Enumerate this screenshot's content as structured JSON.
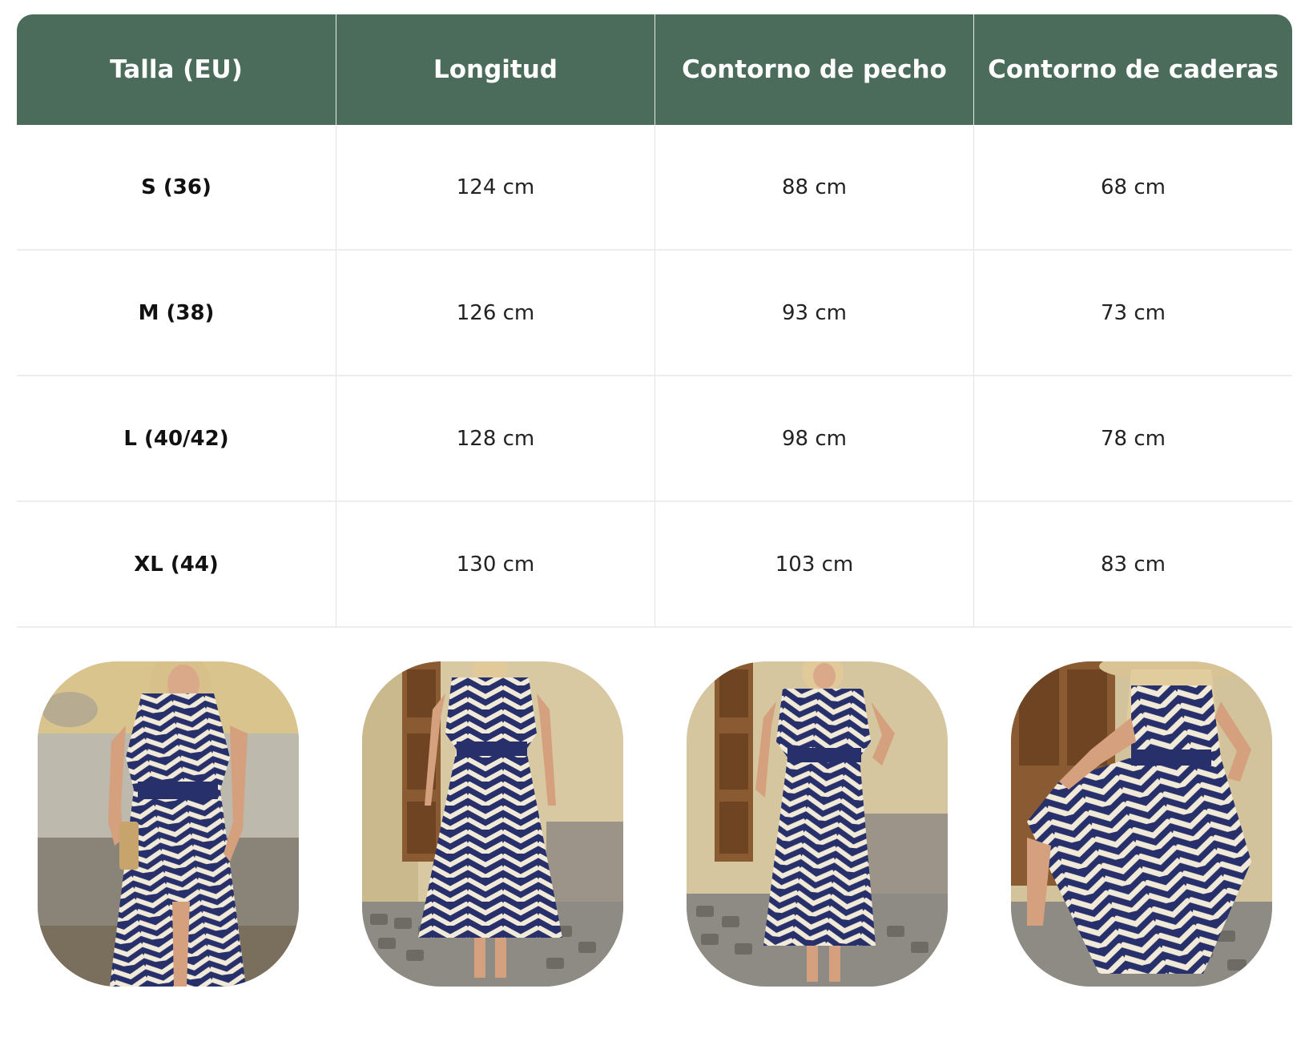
{
  "table": {
    "headers": [
      "Talla (EU)",
      "Longitud",
      "Contorno de pecho",
      "Contorno de caderas"
    ],
    "rows": [
      [
        "S (36)",
        "124 cm",
        "88 cm",
        "68 cm"
      ],
      [
        "M (38)",
        "126 cm",
        "93 cm",
        "73 cm"
      ],
      [
        "L (40/42)",
        "128 cm",
        "98 cm",
        "78 cm"
      ],
      [
        "XL (44)",
        "130 cm",
        "103 cm",
        "83 cm"
      ]
    ]
  },
  "colors": {
    "header_bg": "#4b6b5b",
    "header_text": "#ffffff",
    "dress_navy": "#27306a",
    "dress_cream": "#f1ead8"
  },
  "gallery": {
    "photos": [
      {
        "subject": "model-front-leaning-wall-with-clutch-photo"
      },
      {
        "subject": "model-back-view-photo"
      },
      {
        "subject": "model-front-view-photo"
      },
      {
        "subject": "model-seated-with-hat-photo"
      }
    ]
  }
}
